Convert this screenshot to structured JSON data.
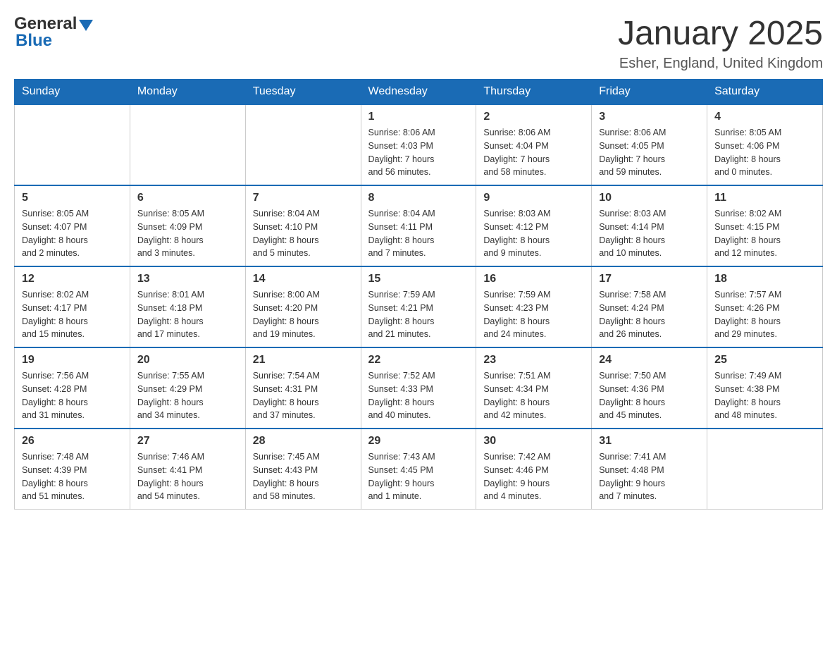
{
  "header": {
    "logo": {
      "general": "General",
      "blue": "Blue"
    },
    "title": "January 2025",
    "location": "Esher, England, United Kingdom"
  },
  "calendar": {
    "days_of_week": [
      "Sunday",
      "Monday",
      "Tuesday",
      "Wednesday",
      "Thursday",
      "Friday",
      "Saturday"
    ],
    "weeks": [
      [
        {
          "day": "",
          "info": ""
        },
        {
          "day": "",
          "info": ""
        },
        {
          "day": "",
          "info": ""
        },
        {
          "day": "1",
          "info": "Sunrise: 8:06 AM\nSunset: 4:03 PM\nDaylight: 7 hours\nand 56 minutes."
        },
        {
          "day": "2",
          "info": "Sunrise: 8:06 AM\nSunset: 4:04 PM\nDaylight: 7 hours\nand 58 minutes."
        },
        {
          "day": "3",
          "info": "Sunrise: 8:06 AM\nSunset: 4:05 PM\nDaylight: 7 hours\nand 59 minutes."
        },
        {
          "day": "4",
          "info": "Sunrise: 8:05 AM\nSunset: 4:06 PM\nDaylight: 8 hours\nand 0 minutes."
        }
      ],
      [
        {
          "day": "5",
          "info": "Sunrise: 8:05 AM\nSunset: 4:07 PM\nDaylight: 8 hours\nand 2 minutes."
        },
        {
          "day": "6",
          "info": "Sunrise: 8:05 AM\nSunset: 4:09 PM\nDaylight: 8 hours\nand 3 minutes."
        },
        {
          "day": "7",
          "info": "Sunrise: 8:04 AM\nSunset: 4:10 PM\nDaylight: 8 hours\nand 5 minutes."
        },
        {
          "day": "8",
          "info": "Sunrise: 8:04 AM\nSunset: 4:11 PM\nDaylight: 8 hours\nand 7 minutes."
        },
        {
          "day": "9",
          "info": "Sunrise: 8:03 AM\nSunset: 4:12 PM\nDaylight: 8 hours\nand 9 minutes."
        },
        {
          "day": "10",
          "info": "Sunrise: 8:03 AM\nSunset: 4:14 PM\nDaylight: 8 hours\nand 10 minutes."
        },
        {
          "day": "11",
          "info": "Sunrise: 8:02 AM\nSunset: 4:15 PM\nDaylight: 8 hours\nand 12 minutes."
        }
      ],
      [
        {
          "day": "12",
          "info": "Sunrise: 8:02 AM\nSunset: 4:17 PM\nDaylight: 8 hours\nand 15 minutes."
        },
        {
          "day": "13",
          "info": "Sunrise: 8:01 AM\nSunset: 4:18 PM\nDaylight: 8 hours\nand 17 minutes."
        },
        {
          "day": "14",
          "info": "Sunrise: 8:00 AM\nSunset: 4:20 PM\nDaylight: 8 hours\nand 19 minutes."
        },
        {
          "day": "15",
          "info": "Sunrise: 7:59 AM\nSunset: 4:21 PM\nDaylight: 8 hours\nand 21 minutes."
        },
        {
          "day": "16",
          "info": "Sunrise: 7:59 AM\nSunset: 4:23 PM\nDaylight: 8 hours\nand 24 minutes."
        },
        {
          "day": "17",
          "info": "Sunrise: 7:58 AM\nSunset: 4:24 PM\nDaylight: 8 hours\nand 26 minutes."
        },
        {
          "day": "18",
          "info": "Sunrise: 7:57 AM\nSunset: 4:26 PM\nDaylight: 8 hours\nand 29 minutes."
        }
      ],
      [
        {
          "day": "19",
          "info": "Sunrise: 7:56 AM\nSunset: 4:28 PM\nDaylight: 8 hours\nand 31 minutes."
        },
        {
          "day": "20",
          "info": "Sunrise: 7:55 AM\nSunset: 4:29 PM\nDaylight: 8 hours\nand 34 minutes."
        },
        {
          "day": "21",
          "info": "Sunrise: 7:54 AM\nSunset: 4:31 PM\nDaylight: 8 hours\nand 37 minutes."
        },
        {
          "day": "22",
          "info": "Sunrise: 7:52 AM\nSunset: 4:33 PM\nDaylight: 8 hours\nand 40 minutes."
        },
        {
          "day": "23",
          "info": "Sunrise: 7:51 AM\nSunset: 4:34 PM\nDaylight: 8 hours\nand 42 minutes."
        },
        {
          "day": "24",
          "info": "Sunrise: 7:50 AM\nSunset: 4:36 PM\nDaylight: 8 hours\nand 45 minutes."
        },
        {
          "day": "25",
          "info": "Sunrise: 7:49 AM\nSunset: 4:38 PM\nDaylight: 8 hours\nand 48 minutes."
        }
      ],
      [
        {
          "day": "26",
          "info": "Sunrise: 7:48 AM\nSunset: 4:39 PM\nDaylight: 8 hours\nand 51 minutes."
        },
        {
          "day": "27",
          "info": "Sunrise: 7:46 AM\nSunset: 4:41 PM\nDaylight: 8 hours\nand 54 minutes."
        },
        {
          "day": "28",
          "info": "Sunrise: 7:45 AM\nSunset: 4:43 PM\nDaylight: 8 hours\nand 58 minutes."
        },
        {
          "day": "29",
          "info": "Sunrise: 7:43 AM\nSunset: 4:45 PM\nDaylight: 9 hours\nand 1 minute."
        },
        {
          "day": "30",
          "info": "Sunrise: 7:42 AM\nSunset: 4:46 PM\nDaylight: 9 hours\nand 4 minutes."
        },
        {
          "day": "31",
          "info": "Sunrise: 7:41 AM\nSunset: 4:48 PM\nDaylight: 9 hours\nand 7 minutes."
        },
        {
          "day": "",
          "info": ""
        }
      ]
    ]
  }
}
